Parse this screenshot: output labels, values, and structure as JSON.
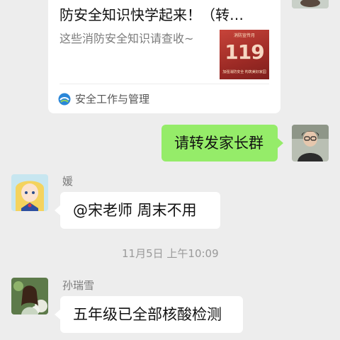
{
  "shared_card": {
    "title": "防安全知识快学起来！（转…",
    "description": "这些消防安全知识请查收~",
    "thumbnail": {
      "top_text": "消防宣传月",
      "number": "119",
      "bottom_text": "加强消防安全  构筑美好家园"
    },
    "source_name": "安全工作与管理"
  },
  "messages": [
    {
      "sender": "self",
      "text": "请转发家长群"
    },
    {
      "sender": "媛",
      "text": "@宋老师  周末不用"
    },
    {
      "sender": "孙瑞雪",
      "text": "五年级已全部核酸检测"
    }
  ],
  "timestamp": "11月5日 上午10:09",
  "colors": {
    "background": "#ededed",
    "self_bubble": "#95ec69",
    "other_bubble": "#ffffff",
    "thumb_red": "#c7443a"
  }
}
